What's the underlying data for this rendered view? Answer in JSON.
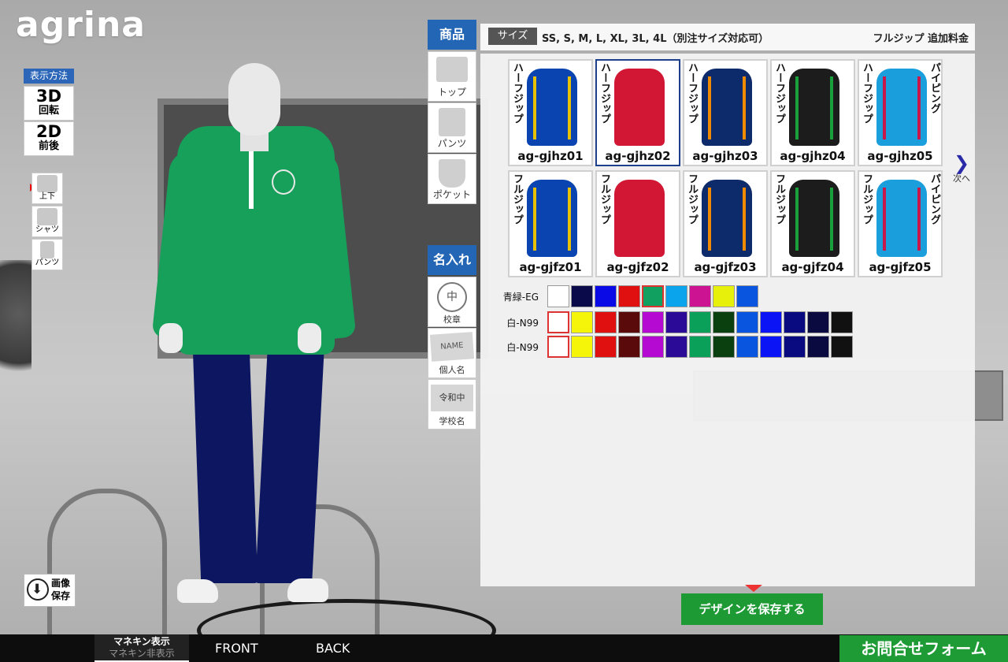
{
  "app": {
    "logo": "agrina"
  },
  "display_mode": {
    "heading": "表示方法",
    "options": [
      {
        "big": "3D",
        "small": "回転",
        "selected": true
      },
      {
        "big": "2D",
        "small": "前後",
        "selected": false
      }
    ]
  },
  "view_parts": [
    {
      "label": "上下",
      "icon": "top-bottom-icon",
      "selected": true
    },
    {
      "label": "シャツ",
      "icon": "shirt-icon",
      "selected": false
    },
    {
      "label": "パンツ",
      "icon": "pants-icon",
      "selected": false
    }
  ],
  "save_image": {
    "label_line1": "画像",
    "label_line2": "保存",
    "icon": "download-icon"
  },
  "product_menu": {
    "heading": "商品",
    "items": [
      {
        "label": "トップ",
        "icon": "top-icon",
        "selected": true
      },
      {
        "label": "パンツ",
        "icon": "pants-icon",
        "selected": false
      },
      {
        "label": "ポケット",
        "icon": "pocket-icon",
        "selected": false
      }
    ]
  },
  "name_menu": {
    "heading": "名入れ",
    "items": [
      {
        "label": "校章",
        "icon": "school-emblem-icon",
        "preview_text": "中"
      },
      {
        "label": "個人名",
        "icon": "personal-name-icon",
        "preview_text": "NAME"
      },
      {
        "label": "学校名",
        "icon": "school-name-icon",
        "preview_text": "令和中"
      }
    ]
  },
  "size": {
    "tag": "サイズ",
    "list": "SS, S, M, L, XL, 3L, 4L（別注サイズ対応可）",
    "fullzip_note": "フルジップ 追加料金"
  },
  "products": [
    {
      "code": "ag-gjhz01",
      "label": "ハーフジップ",
      "side_label": "",
      "body": "#0a44b0",
      "stripe": "#e8c200",
      "selected": false
    },
    {
      "code": "ag-gjhz02",
      "label": "ハーフジップ",
      "side_label": "",
      "body": "#d21734",
      "stripe": "#d21734",
      "selected": true
    },
    {
      "code": "ag-gjhz03",
      "label": "ハーフジップ",
      "side_label": "",
      "body": "#0d2a6b",
      "stripe": "#f08a00",
      "selected": false
    },
    {
      "code": "ag-gjhz04",
      "label": "ハーフジップ",
      "side_label": "",
      "body": "#1c1c1c",
      "stripe": "#1aa03a",
      "selected": false
    },
    {
      "code": "ag-gjhz05",
      "label": "ハーフジップ",
      "side_label": "パイピング",
      "body": "#1a9fdc",
      "stripe": "#c8174a",
      "selected": false
    },
    {
      "code": "ag-gjfz01",
      "label": "フルジップ",
      "side_label": "",
      "body": "#0a44b0",
      "stripe": "#e8c200",
      "selected": false
    },
    {
      "code": "ag-gjfz02",
      "label": "フルジップ",
      "side_label": "",
      "body": "#d21734",
      "stripe": "#d21734",
      "selected": false
    },
    {
      "code": "ag-gjfz03",
      "label": "フルジップ",
      "side_label": "",
      "body": "#0d2a6b",
      "stripe": "#f08a00",
      "selected": false
    },
    {
      "code": "ag-gjfz04",
      "label": "フルジップ",
      "side_label": "",
      "body": "#1c1c1c",
      "stripe": "#1aa03a",
      "selected": false
    },
    {
      "code": "ag-gjfz05",
      "label": "フルジップ",
      "side_label": "パイピング",
      "body": "#1a9fdc",
      "stripe": "#c8174a",
      "selected": false
    }
  ],
  "next_label": "次へ",
  "color_rows": [
    {
      "label": "青緑-EG",
      "colors": [
        "#ffffff",
        "#0a0a4a",
        "#0a0ae6",
        "#e01010",
        "#12a060",
        "#0aa4ec",
        "#cc1493",
        "#e6f00a",
        "#0a55e0"
      ],
      "selected_index": 4
    },
    {
      "label": "白-N99",
      "colors": [
        "#ffffff",
        "#f5f50a",
        "#e01010",
        "#5a0a0a",
        "#b40ad2",
        "#2a0a96",
        "#0aa05a",
        "#0a4010",
        "#0a55e0",
        "#0a14f5",
        "#0a0a80",
        "#0a0a40",
        "#111111"
      ],
      "selected_index": 0
    },
    {
      "label": "白-N99",
      "colors": [
        "#ffffff",
        "#f5f50a",
        "#e01010",
        "#5a0a0a",
        "#b40ad2",
        "#2a0a96",
        "#0aa05a",
        "#0a4010",
        "#0a55e0",
        "#0a14f5",
        "#0a0a80",
        "#0a0a40",
        "#111111"
      ],
      "selected_index": 0
    }
  ],
  "mannequin": {
    "jacket_color": "#16a05a",
    "pants_color": "#0d1660"
  },
  "save_design_label": "デザインを保存する",
  "bottom": {
    "mannequin_show": "マネキン表示",
    "mannequin_hide": "マネキン非表示",
    "front": "FRONT",
    "back": "BACK",
    "contact": "お問合せフォーム"
  }
}
